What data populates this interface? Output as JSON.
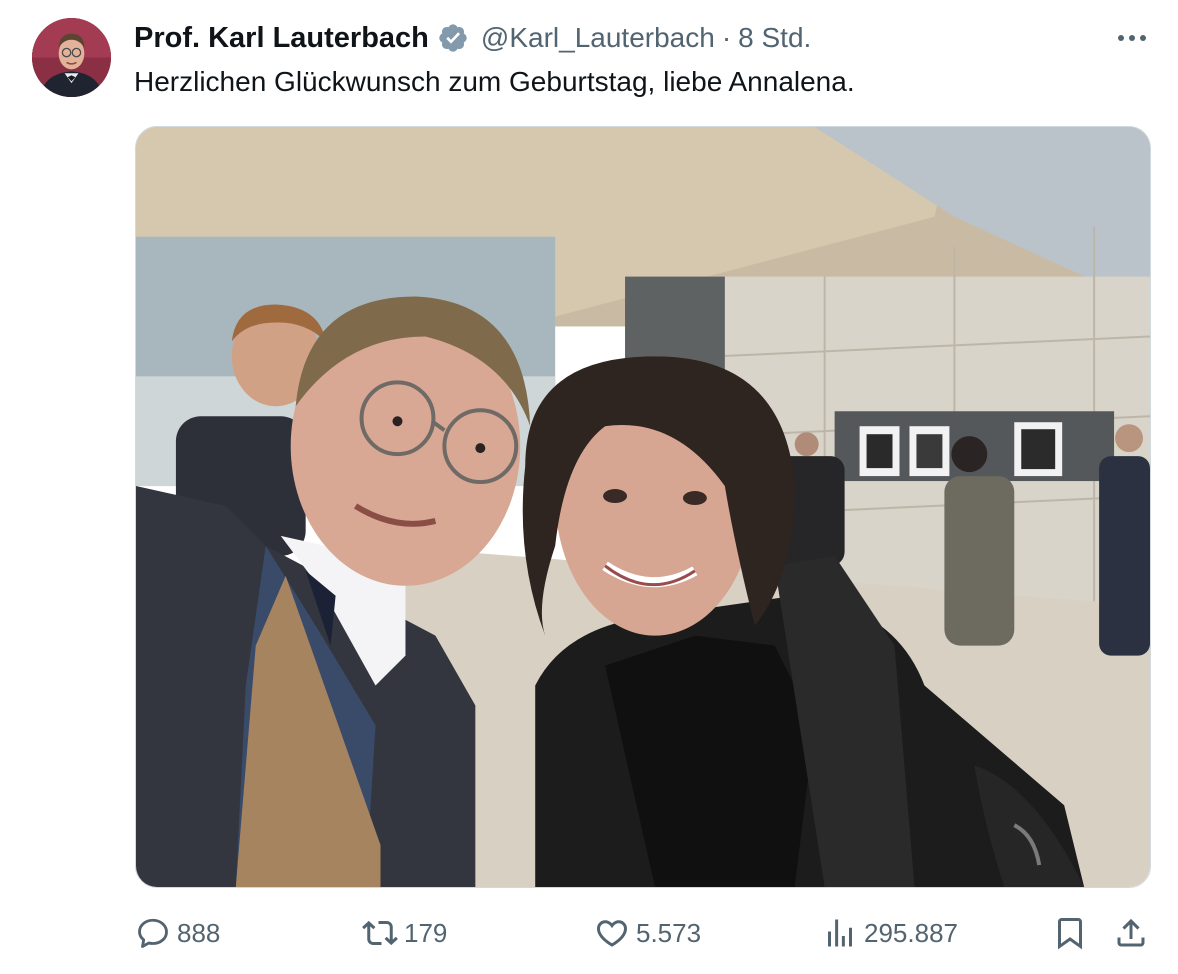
{
  "author": {
    "name": "Prof. Karl Lauterbach",
    "handle": "@Karl_Lauterbach",
    "separator": "·",
    "time": "8 Std."
  },
  "tweet": {
    "text": "Herzlichen Glückwunsch zum Geburtstag, liebe Annalena."
  },
  "stats": {
    "replies": "888",
    "retweets": "179",
    "likes": "5.573",
    "views": "295.887"
  },
  "icons": {
    "verified": "verified-badge-icon",
    "more": "more-dots-icon",
    "reply": "reply-icon",
    "retweet": "retweet-icon",
    "like": "heart-icon",
    "views": "views-bar-chart-icon",
    "bookmark": "bookmark-icon",
    "share": "share-icon"
  },
  "colors": {
    "text_primary": "#0f1419",
    "text_secondary": "#536471",
    "verified": "#829aab"
  }
}
